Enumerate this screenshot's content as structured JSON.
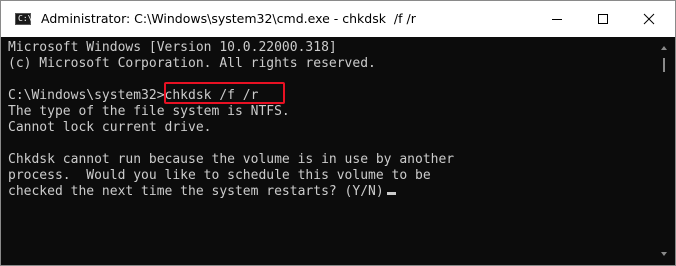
{
  "window": {
    "title": "Administrator: C:\\Windows\\system32\\cmd.exe - chkdsk  /f /r",
    "icon_name": "cmd-icon",
    "icon_text": "C:\\"
  },
  "controls": {
    "minimize": "minimize-icon",
    "maximize": "maximize-icon",
    "close": "close-icon"
  },
  "console": {
    "lines": [
      "Microsoft Windows [Version 10.0.22000.318]",
      "(c) Microsoft Corporation. All rights reserved.",
      "",
      "C:\\Windows\\system32>chkdsk /f /r",
      "The type of the file system is NTFS.",
      "Cannot lock current drive.",
      "",
      "Chkdsk cannot run because the volume is in use by another",
      "process.  Would you like to schedule this volume to be",
      "checked the next time the system restarts? (Y/N)"
    ]
  },
  "colors": {
    "console_bg": "#0c0c0c",
    "console_text": "#cccccc",
    "highlight": "#e81123"
  }
}
